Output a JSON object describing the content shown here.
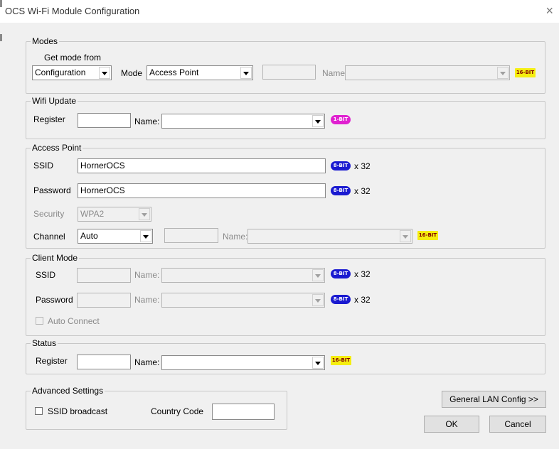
{
  "window": {
    "title": "OCS Wi-Fi Module Configuration",
    "close_glyph": "×"
  },
  "modes": {
    "legend": "Modes",
    "get_mode_from_label": "Get mode from",
    "get_mode_from_value": "Configuration",
    "mode_label": "Mode",
    "mode_value": "Access Point",
    "register_value": "",
    "name_label": "Name:",
    "name_value": "",
    "badge": "16-BIT"
  },
  "wifi_update": {
    "legend": "Wifi Update",
    "register_label": "Register",
    "register_value": "",
    "name_label": "Name:",
    "name_value": "",
    "badge": "1-BIT"
  },
  "access_point": {
    "legend": "Access Point",
    "ssid_label": "SSID",
    "ssid_value": "HornerOCS",
    "ssid_badge": "8-BIT",
    "ssid_mult": "x 32",
    "password_label": "Password",
    "password_value": "HornerOCS",
    "password_badge": "8-BIT",
    "password_mult": "x 32",
    "security_label": "Security",
    "security_value": "WPA2",
    "channel_label": "Channel",
    "channel_value": "Auto",
    "channel_register_value": "",
    "name_label": "Name:",
    "name_value": "",
    "badge": "16-BIT"
  },
  "client_mode": {
    "legend": "Client Mode",
    "ssid_label": "SSID",
    "ssid_name_label": "Name:",
    "ssid_badge": "8-BIT",
    "ssid_mult": "x 32",
    "password_label": "Password",
    "password_name_label": "Name:",
    "password_badge": "8-BIT",
    "password_mult": "x 32",
    "auto_connect_label": "Auto Connect"
  },
  "status": {
    "legend": "Status",
    "register_label": "Register",
    "register_value": "",
    "name_label": "Name:",
    "name_value": "",
    "badge": "16-BIT"
  },
  "advanced": {
    "legend": "Advanced Settings",
    "ssid_broadcast_label": "SSID broadcast",
    "country_code_label": "Country Code",
    "country_code_value": ""
  },
  "buttons": {
    "general_lan": "General LAN Config >>",
    "ok": "OK",
    "cancel": "Cancel"
  },
  "colors": {
    "badge_16bit": "#f5ee10",
    "badge_8bit": "#1a1ad0",
    "badge_1bit": "#e020d0"
  }
}
